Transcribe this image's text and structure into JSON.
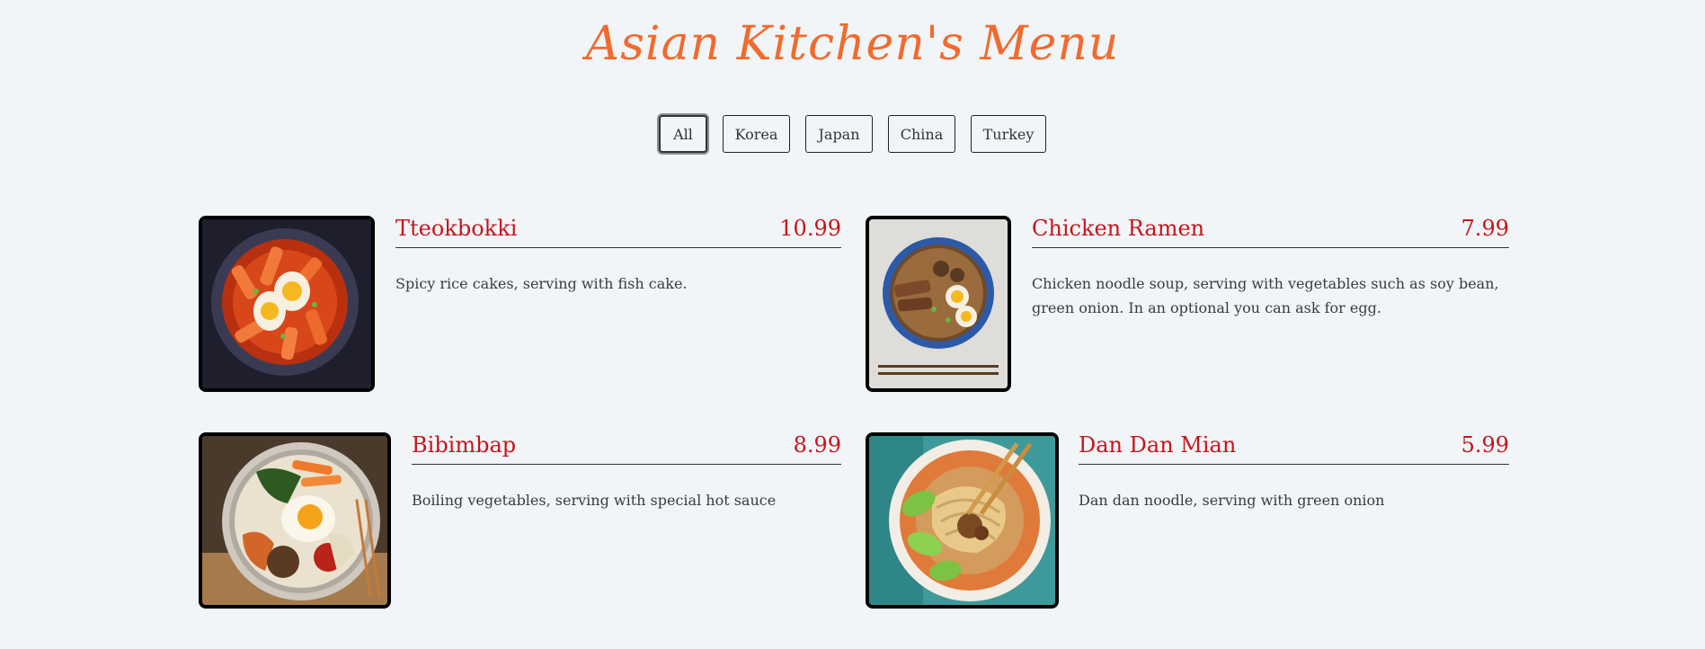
{
  "title": "Asian Kitchen's Menu",
  "filters": [
    {
      "label": "All",
      "active": true
    },
    {
      "label": "Korea",
      "active": false
    },
    {
      "label": "Japan",
      "active": false
    },
    {
      "label": "China",
      "active": false
    },
    {
      "label": "Turkey",
      "active": false
    }
  ],
  "menu": [
    {
      "name": "Tteokbokki",
      "price": "10.99",
      "desc": "Spicy rice cakes, serving with fish cake.",
      "image": "tteokbokki-photo"
    },
    {
      "name": "Chicken Ramen",
      "price": "7.99",
      "desc": "Chicken noodle soup, serving with vegetables such as soy bean, green onion. In an optional you can ask for egg.",
      "image": "chicken-ramen-photo"
    },
    {
      "name": "Bibimbap",
      "price": "8.99",
      "desc": "Boiling vegetables, serving with special hot sauce",
      "image": "bibimbap-photo"
    },
    {
      "name": "Dan Dan Mian",
      "price": "5.99",
      "desc": "Dan dan noodle, serving with green onion",
      "image": "dan-dan-mian-photo"
    }
  ],
  "colors": {
    "background": "#f1f5f8",
    "title": "#f26a2e",
    "item_text": "#c7151a",
    "body_text": "#3b3b3b"
  }
}
